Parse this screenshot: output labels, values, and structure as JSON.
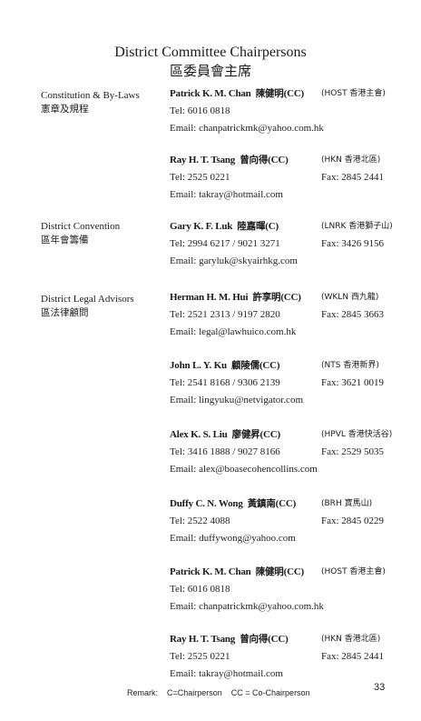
{
  "title_en": "District Committee Chairpersons",
  "title_zh": "區委員會主席",
  "sections": [
    {
      "en": "Constitution & By-Laws",
      "zh": "憲章及規程"
    },
    {
      "en": "District Convention",
      "zh": "區年會籌備"
    },
    {
      "en": "District Legal Advisors",
      "zh": "區法律顧問"
    }
  ],
  "entries": [
    {
      "name_en": "Patrick K. M. Chan",
      "name_zh": "陳健明",
      "role": "(CC)",
      "district": "(HOST  香港主會)",
      "tel": "Tel: 6016 0818",
      "fax": "",
      "email": "Email: chanpatrickmk@yahoo.com.hk"
    },
    {
      "name_en": "Ray H. T. Tsang",
      "name_zh": "曾向得",
      "role": "(CC)",
      "district": "(HKN  香港北區)",
      "tel": "Tel: 2525 0221",
      "fax": "Fax: 2845 2441",
      "email": "Email: takray@hotmail.com"
    },
    {
      "name_en": "Gary K. F. Luk",
      "name_zh": "陸嘉暉",
      "role": "(C)",
      "district": "(LNRK  香港獅子山)",
      "tel": "Tel: 2994 6217 / 9021 3271",
      "fax": "Fax: 3426 9156",
      "email": "Email: garyluk@skyairhkg.com"
    },
    {
      "name_en": "Herman H. M. Hui",
      "name_zh": "許享明",
      "role": "(CC)",
      "district": "(WKLN  西九龍)",
      "tel": "Tel: 2521 2313 / 9197 2820",
      "fax": "Fax: 2845 3663",
      "email": "Email: legal@lawhuico.com.hk"
    },
    {
      "name_en": "John L. Y. Ku",
      "name_zh": "顧陵儒",
      "role": "(CC)",
      "district": "(NTS  香港新界)",
      "tel": "Tel: 2541 8168 / 9306 2139",
      "fax": "Fax: 3621 0019",
      "email": "Email: lingyuku@netvigator.com"
    },
    {
      "name_en": "Alex K. S. Liu",
      "name_zh": "廖健昇",
      "role": "(CC)",
      "district": "(HPVL  香港快活谷)",
      "tel": "Tel: 3416 1888 / 9027 8166",
      "fax": "Fax: 2529 5035",
      "email": "Email: alex@boasecohencollins.com"
    },
    {
      "name_en": "Duffy C. N. Wong",
      "name_zh": "黃鎮南",
      "role": "(CC)",
      "district": "(BRH  寶馬山)",
      "tel": "Tel: 2522 4088",
      "fax": "Fax: 2845 0229",
      "email": "Email: duffywong@yahoo.com"
    },
    {
      "name_en": "Patrick K. M. Chan",
      "name_zh": "陳健明",
      "role": "(CC)",
      "district": "(HOST  香港主會)",
      "tel": "Tel: 6016 0818",
      "fax": "",
      "email": "Email: chanpatrickmk@yahoo.com.hk"
    },
    {
      "name_en": "Ray H. T. Tsang",
      "name_zh": "曾向得",
      "role": "(CC)",
      "district": "(HKN  香港北區)",
      "tel": "Tel: 2525 0221",
      "fax": "Fax: 2845 2441",
      "email": "Email: takray@hotmail.com"
    }
  ],
  "remark": "Remark:    C=Chairperson    CC = Co-Chairperson",
  "page_number": "33"
}
